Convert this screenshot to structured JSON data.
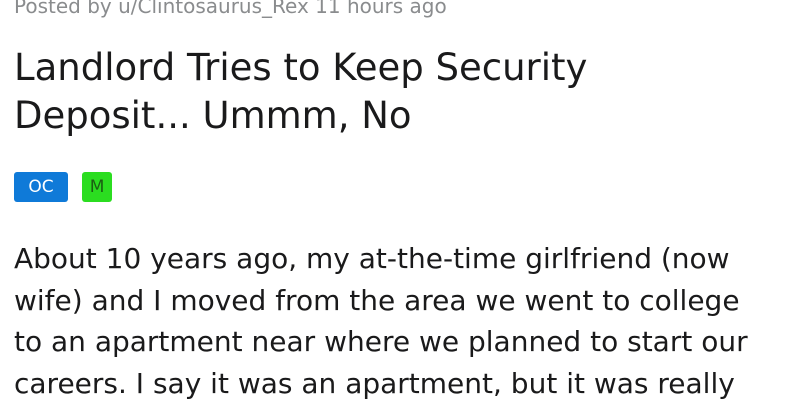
{
  "post": {
    "meta": "Posted by u/Clintosaurus_Rex 11 hours ago",
    "title_lines": [
      "Landlord Tries to Keep Security",
      "Deposit... Ummm, No"
    ],
    "flairs": [
      {
        "label": "OC",
        "color": "#0f7ad8"
      },
      {
        "label": "M",
        "color": "#2bdd20"
      }
    ],
    "body_lines": [
      "About 10 years ago, my at-the-time girlfriend (now",
      "wife) and I moved from the area we went to college",
      "to an apartment near where we planned to start our",
      "careers. I say it was an apartment, but it was really"
    ]
  }
}
